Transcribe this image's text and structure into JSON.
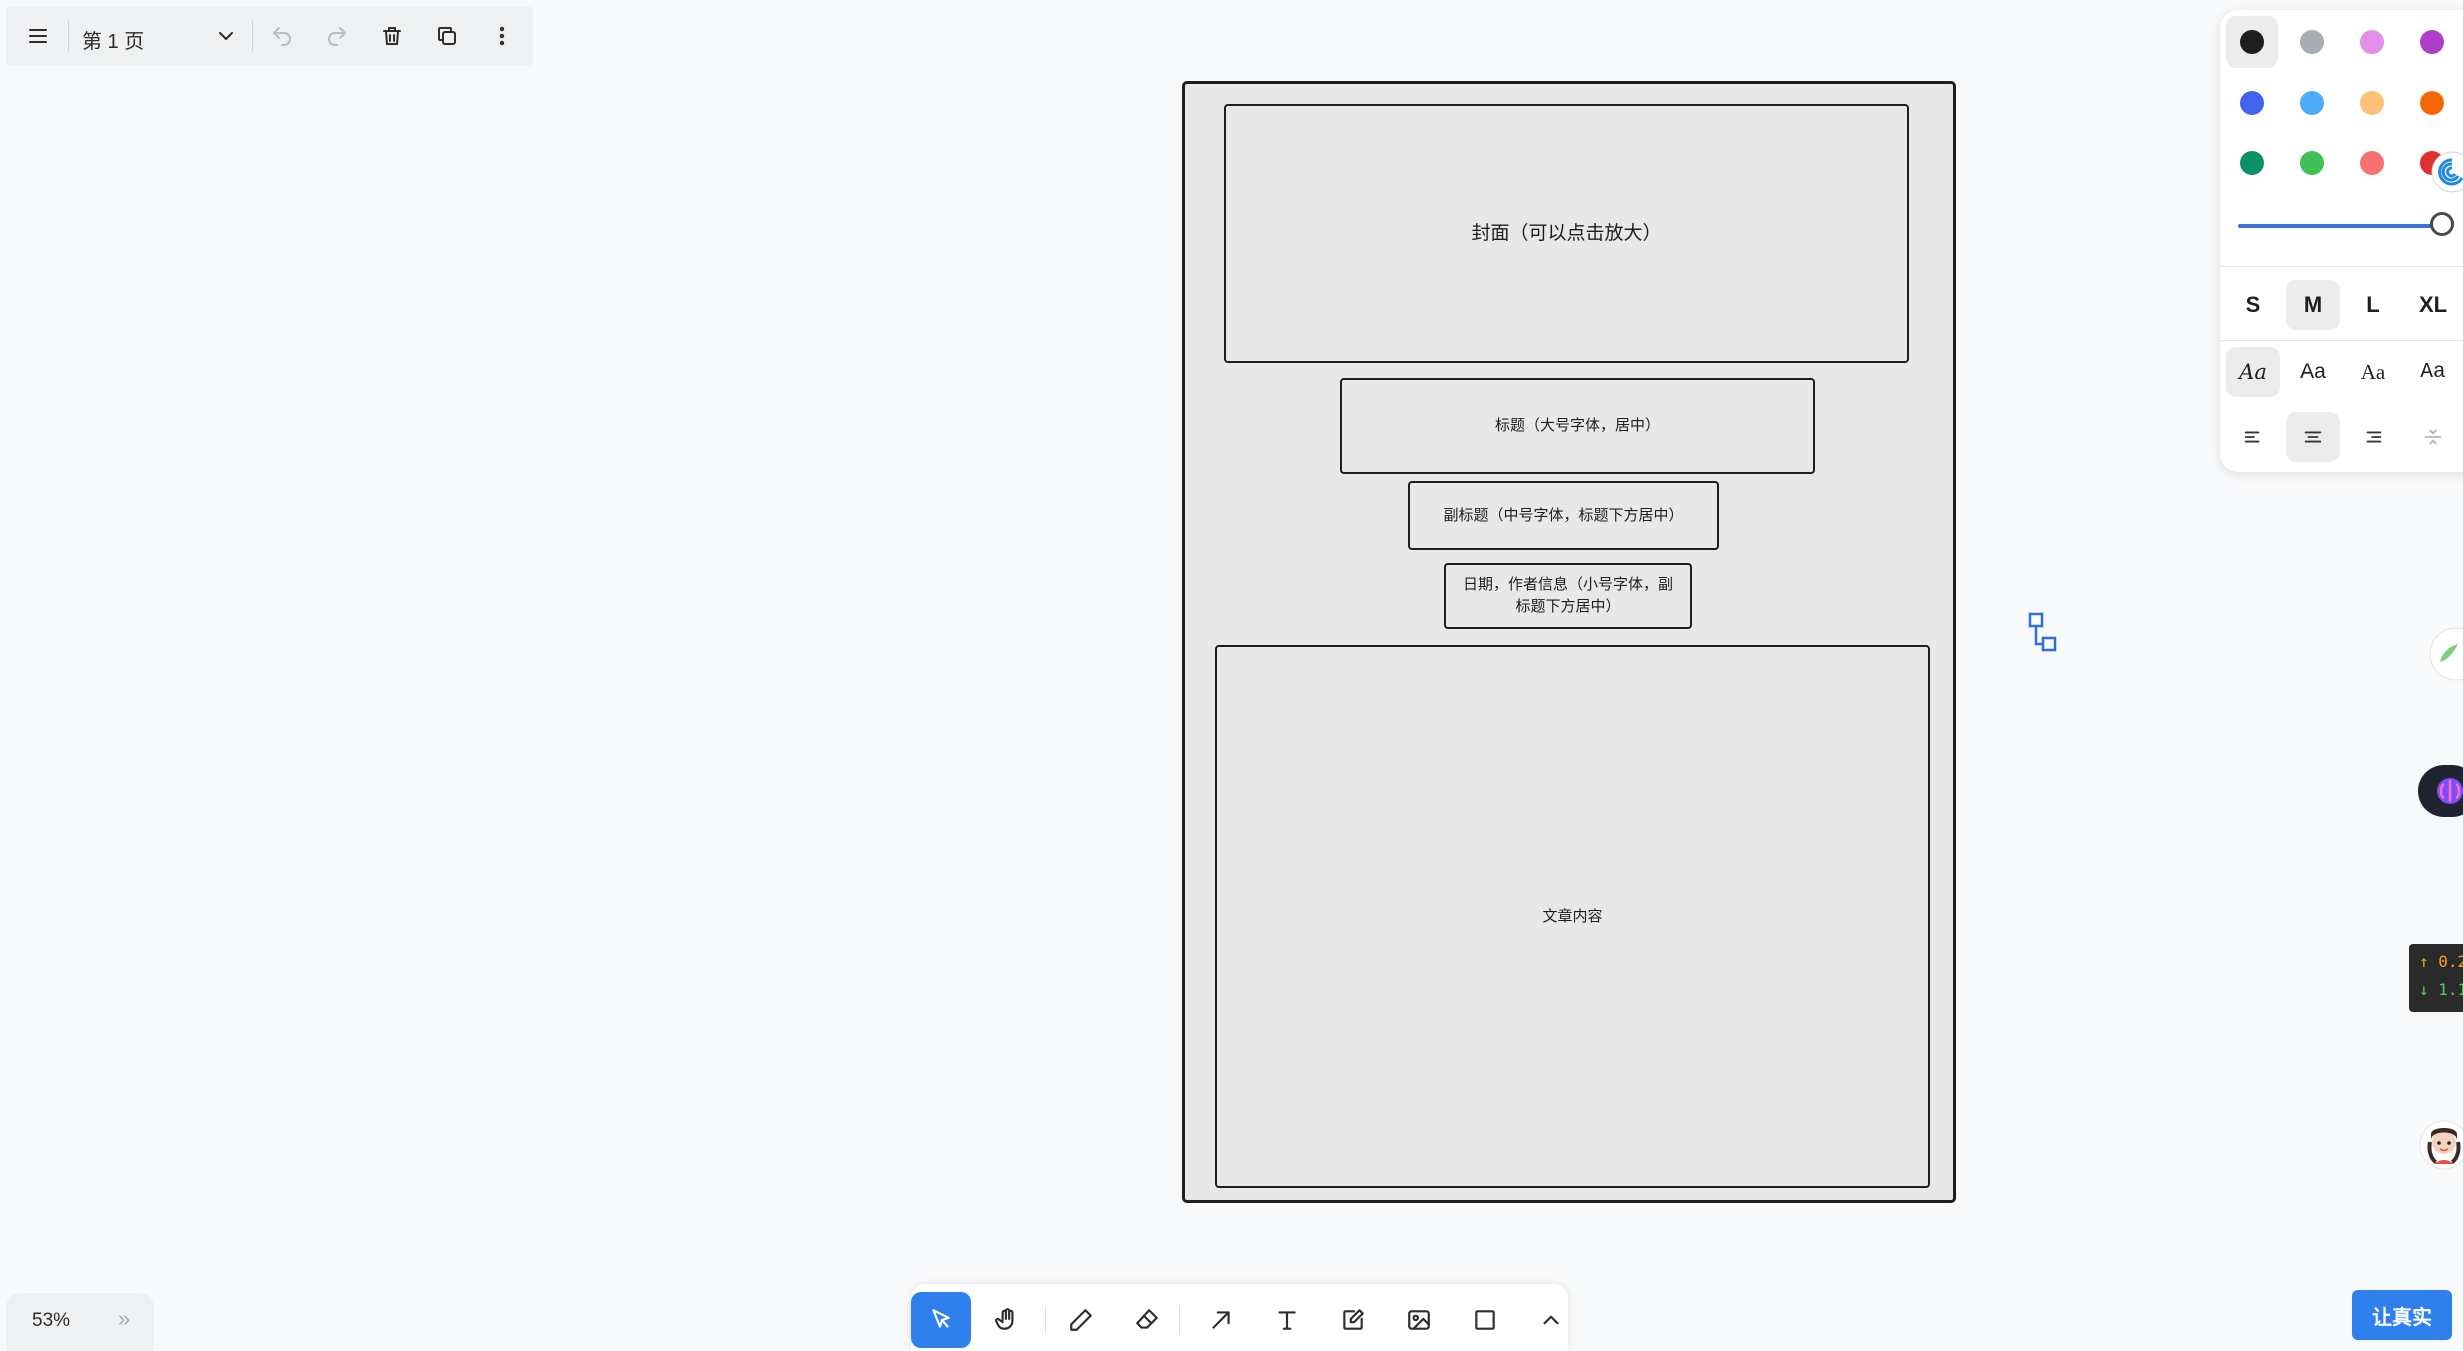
{
  "topbar": {
    "page_label": "第 1 页",
    "icons": [
      "menu-icon",
      "chevron-down-icon",
      "undo-icon",
      "redo-icon",
      "trash-icon",
      "duplicate-icon",
      "more-vertical-icon"
    ]
  },
  "document": {
    "cover": "封面（可以点击放大）",
    "title": "标题（大号字体，居中）",
    "subtitle": "副标题（中号字体，标题下方居中）",
    "meta": "日期，作者信息（小号字体，副标题下方居中）",
    "content": "文章内容"
  },
  "style_panel": {
    "colors": [
      "#1e1e1e",
      "#a7adb3",
      "#e28fe8",
      "#ae3ec9",
      "#4263eb",
      "#4dabf7",
      "#ffc078",
      "#f76707",
      "#099268",
      "#40c057",
      "#f87171"
    ],
    "selected_color": "#1e1e1e",
    "opacity": 1.0,
    "sizes": [
      "S",
      "M",
      "L",
      "XL"
    ],
    "selected_size": "M",
    "fonts": [
      "Aa",
      "Aa",
      "Aa",
      "Aa"
    ],
    "selected_font_index": 0,
    "align_options": [
      "align-left-icon",
      "align-center-icon",
      "align-right-icon",
      "vertical-align-icon"
    ],
    "selected_align": "align-center-icon"
  },
  "bottom_toolbar": {
    "tools": [
      "select-tool",
      "hand-tool",
      "draw-tool",
      "eraser-tool",
      "arrow-tool",
      "text-tool",
      "note-tool",
      "image-tool",
      "rectangle-tool",
      "more-tools"
    ],
    "active_tool": "select-tool"
  },
  "zoom": {
    "value": "53%",
    "more": "»"
  },
  "side_widgets": {
    "stats_up": "↑ 0.2",
    "stats_down": "↓ 1.1"
  },
  "real_button": {
    "label": "让真实"
  }
}
